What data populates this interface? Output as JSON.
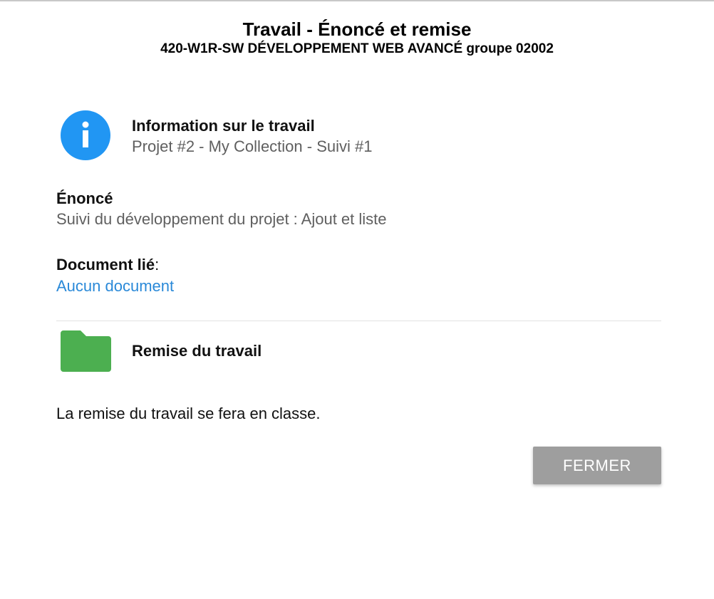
{
  "header": {
    "title": "Travail - Énoncé et remise",
    "subtitle": "420-W1R-SW DÉVELOPPEMENT WEB AVANCÉ groupe 02002"
  },
  "info": {
    "icon": "info-icon",
    "icon_color": "#2196f3",
    "heading": "Information sur le travail",
    "value": "Projet #2 - My Collection - Suivi #1"
  },
  "enonce": {
    "heading": "Énoncé",
    "value": "Suivi du développement du projet : Ajout et liste"
  },
  "document": {
    "heading": "Document lié",
    "separator": ":",
    "link": "Aucun document",
    "link_color": "#2a89d8"
  },
  "remise": {
    "icon": "folder-icon",
    "icon_color": "#4caf50",
    "heading": "Remise du travail",
    "text": "La remise du travail se fera en classe."
  },
  "actions": {
    "close_label": "FERMER",
    "close_color": "#9e9e9e"
  }
}
